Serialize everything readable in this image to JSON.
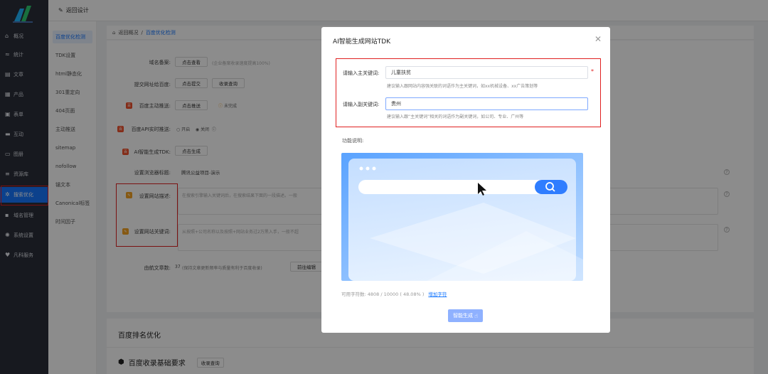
{
  "sidebar": {
    "items": [
      {
        "label": "概况",
        "icon": "home-icon"
      },
      {
        "label": "统计",
        "icon": "chart-icon"
      },
      {
        "label": "文章",
        "icon": "article-icon"
      },
      {
        "label": "产品",
        "icon": "grid-icon"
      },
      {
        "label": "表单",
        "icon": "form-icon"
      },
      {
        "label": "互动",
        "icon": "chat-icon"
      },
      {
        "label": "图册",
        "icon": "album-icon"
      },
      {
        "label": "资源库",
        "icon": "database-icon"
      },
      {
        "label": "搜索优化",
        "icon": "search-gear-icon"
      },
      {
        "label": "域名管理",
        "icon": "domain-icon"
      },
      {
        "label": "系统设置",
        "icon": "gear-icon"
      },
      {
        "label": "凡科服务",
        "icon": "heart-icon"
      }
    ],
    "active_index": 8
  },
  "topbar": {
    "back_label": "返回设计"
  },
  "subnav": {
    "items": [
      "百度优化检测",
      "TDK设置",
      "html静态化",
      "301重定向",
      "404页面",
      "主动推送",
      "sitemap",
      "nofollow",
      "锚文本",
      "Canonical标签",
      "时间因子"
    ],
    "active_index": 0
  },
  "breadcrumb": {
    "home": "返回概况",
    "sep": "/",
    "current": "百度优化检测"
  },
  "form": {
    "domain_record_label": "域名备案:",
    "domain_record_button": "点击查看",
    "domain_record_hint": "(企业备案收录速度提高100%)",
    "submit_baidu_label": "提交网址给百度:",
    "submit_button": "点击提交",
    "record_query_button": "收录查询",
    "active_push_label": "百度主动推送:",
    "active_push_button": "点击推送",
    "active_push_status": "未完成",
    "api_push_label": "百度API实时推送:",
    "api_on": "开启",
    "api_off": "关闭",
    "ai_tdk_label": "AI智能生成TDK:",
    "ai_tdk_button": "点击生成",
    "browser_title_label": "设置浏览器标题:",
    "browser_title_value": "腾讯公益项目-演示",
    "site_desc_label": "设置网站描述:",
    "site_desc_placeholder": "在搜索引擎输入关键词后，在搜索结果下面的一段描述。一般",
    "site_keywords_label": "设置网站关键词:",
    "site_keywords_placeholder": "从按照+公司名称以及按照+网站业务过2万黑入手，一般不超",
    "article_count_label": "由航文章数:",
    "article_count_value": "37",
    "article_count_hint": "(保持文章更新频率与质量有利于百度收录)",
    "go_write_button": "前往编辑"
  },
  "panel2": {
    "title": "百度排名优化",
    "subtitle": "百度收录基础要求",
    "query_button": "收录查询"
  },
  "modal": {
    "title": "AI智能生成网站TDK",
    "main_kw_label": "请输入主关键词:",
    "main_kw_value": "儿童扶贫",
    "main_kw_hint": "建议输入跟网站内容强关联的词语作为主关键词，如xx机械设备、xx广告策划等",
    "sub_kw_label": "请输入副关键词:",
    "sub_kw_value": "贵州",
    "sub_kw_hint": "建议输入跟“主关键词”相关的词语作为副关键词，如公司、专业、广州等",
    "required_mark": "*",
    "func_label": "功能说明:",
    "chars_text": "可用字符数: 4808 / 10000 ( 48.08% )",
    "add_chars_link": "增加字符",
    "generate_button": "智能生成"
  }
}
